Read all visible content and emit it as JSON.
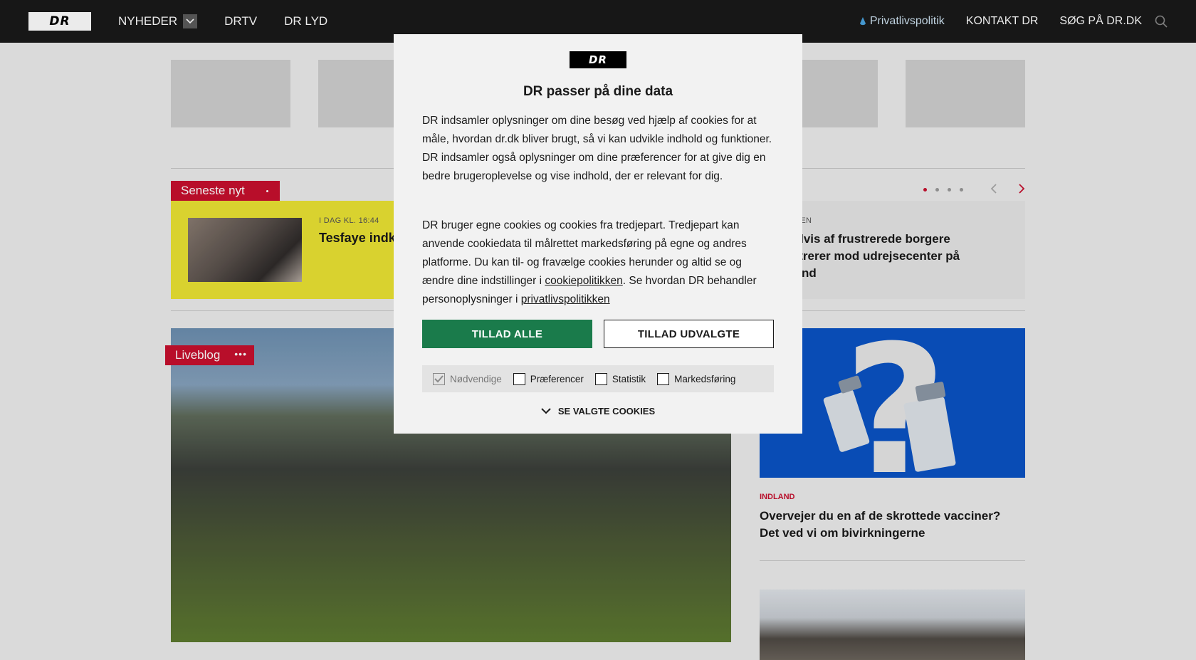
{
  "nav": {
    "logo": "DR",
    "items": [
      "NYHEDER",
      "DRTV",
      "DR LYD"
    ],
    "right": {
      "privacy": "Privatlivspolitik",
      "contact": "KONTAKT DR",
      "search": "SØG PÅ DR.DK"
    }
  },
  "latest": {
    "tag": "Seneste nyt",
    "item1": {
      "time": "I DAG KL. 16:44",
      "title": "Tesfaye indk"
    },
    "item2": {
      "time": "L. SIDEN",
      "title": "dredvis af frustrerede borgere onstrerer mod udrejsecenter på geland"
    },
    "dots_active": 1
  },
  "liveblog": {
    "tag": "Liveblog"
  },
  "article": {
    "category": "INDLAND",
    "title": "Overvejer du en af de skrottede vacciner? Det ved vi om bivirkningerne"
  },
  "modal": {
    "logo": "DR",
    "title": "DR passer på dine data",
    "p1": "DR indsamler oplysninger om dine besøg ved hjælp af cookies for at måle, hvordan dr.dk bliver brugt, så vi kan udvikle indhold og funktioner. DR indsamler også oplysninger om dine præferencer for at give dig en bedre brugeroplevelse og vise indhold, der er relevant for dig.",
    "p2_before": "DR bruger egne cookies og cookies fra tredjepart. Tredjepart kan anvende cookiedata til målrettet markedsføring på egne og andres platforme. Du kan til- og fravælge cookies herunder og altid se og ændre dine indstillinger i ",
    "p2_link1": "cookiepolitikken",
    "p2_middle": ". Se hvordan DR behandler personoplysninger i ",
    "p2_link2": "privatlivspolitikken",
    "btn_all": "TILLAD ALLE",
    "btn_selected": "TILLAD UDVALGTE",
    "checkboxes": [
      {
        "label": "Nødvendige",
        "checked": true,
        "disabled": true
      },
      {
        "label": "Præferencer",
        "checked": false
      },
      {
        "label": "Statistik",
        "checked": false
      },
      {
        "label": "Markedsføring",
        "checked": false
      }
    ],
    "see_cookies": "SE VALGTE COOKIES"
  },
  "colors": {
    "accent_red": "#c8102e",
    "accept_green": "#1a7b4b",
    "nav_bg": "#1a1a1a",
    "latest_yellow": "#ece433",
    "vaccine_blue": "#0a53c5"
  }
}
